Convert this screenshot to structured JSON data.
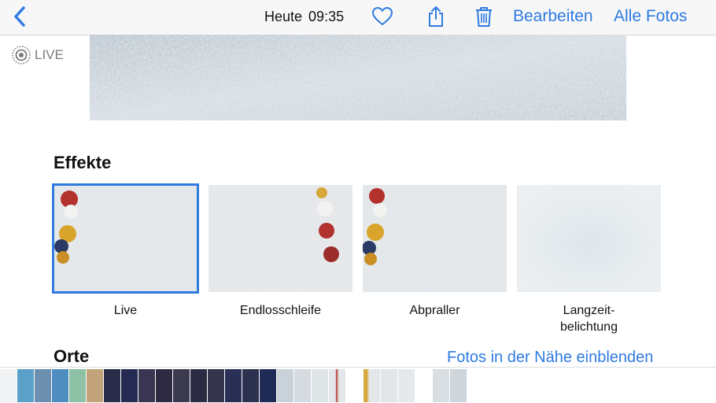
{
  "nav": {
    "title_day": "Heute",
    "title_time": "09:35",
    "edit_label": "Bearbeiten",
    "all_photos_label": "Alle Fotos"
  },
  "live_badge": "LIVE",
  "effects": {
    "title": "Effekte",
    "items": [
      {
        "label": "Live",
        "selected": true
      },
      {
        "label": "Endlosschleife",
        "selected": false
      },
      {
        "label": "Abpraller",
        "selected": false
      },
      {
        "label": "Langzeit-\nbelichtung",
        "selected": false
      }
    ]
  },
  "places": {
    "title": "Orte",
    "nearby_link": "Fotos in der Nähe einblenden"
  },
  "colors": {
    "accent": "#2f7be0"
  },
  "icons": {
    "back": "chevron-left-icon",
    "favorite": "heart-icon",
    "share": "share-icon",
    "delete": "trash-icon",
    "live": "live-photo-icon"
  }
}
